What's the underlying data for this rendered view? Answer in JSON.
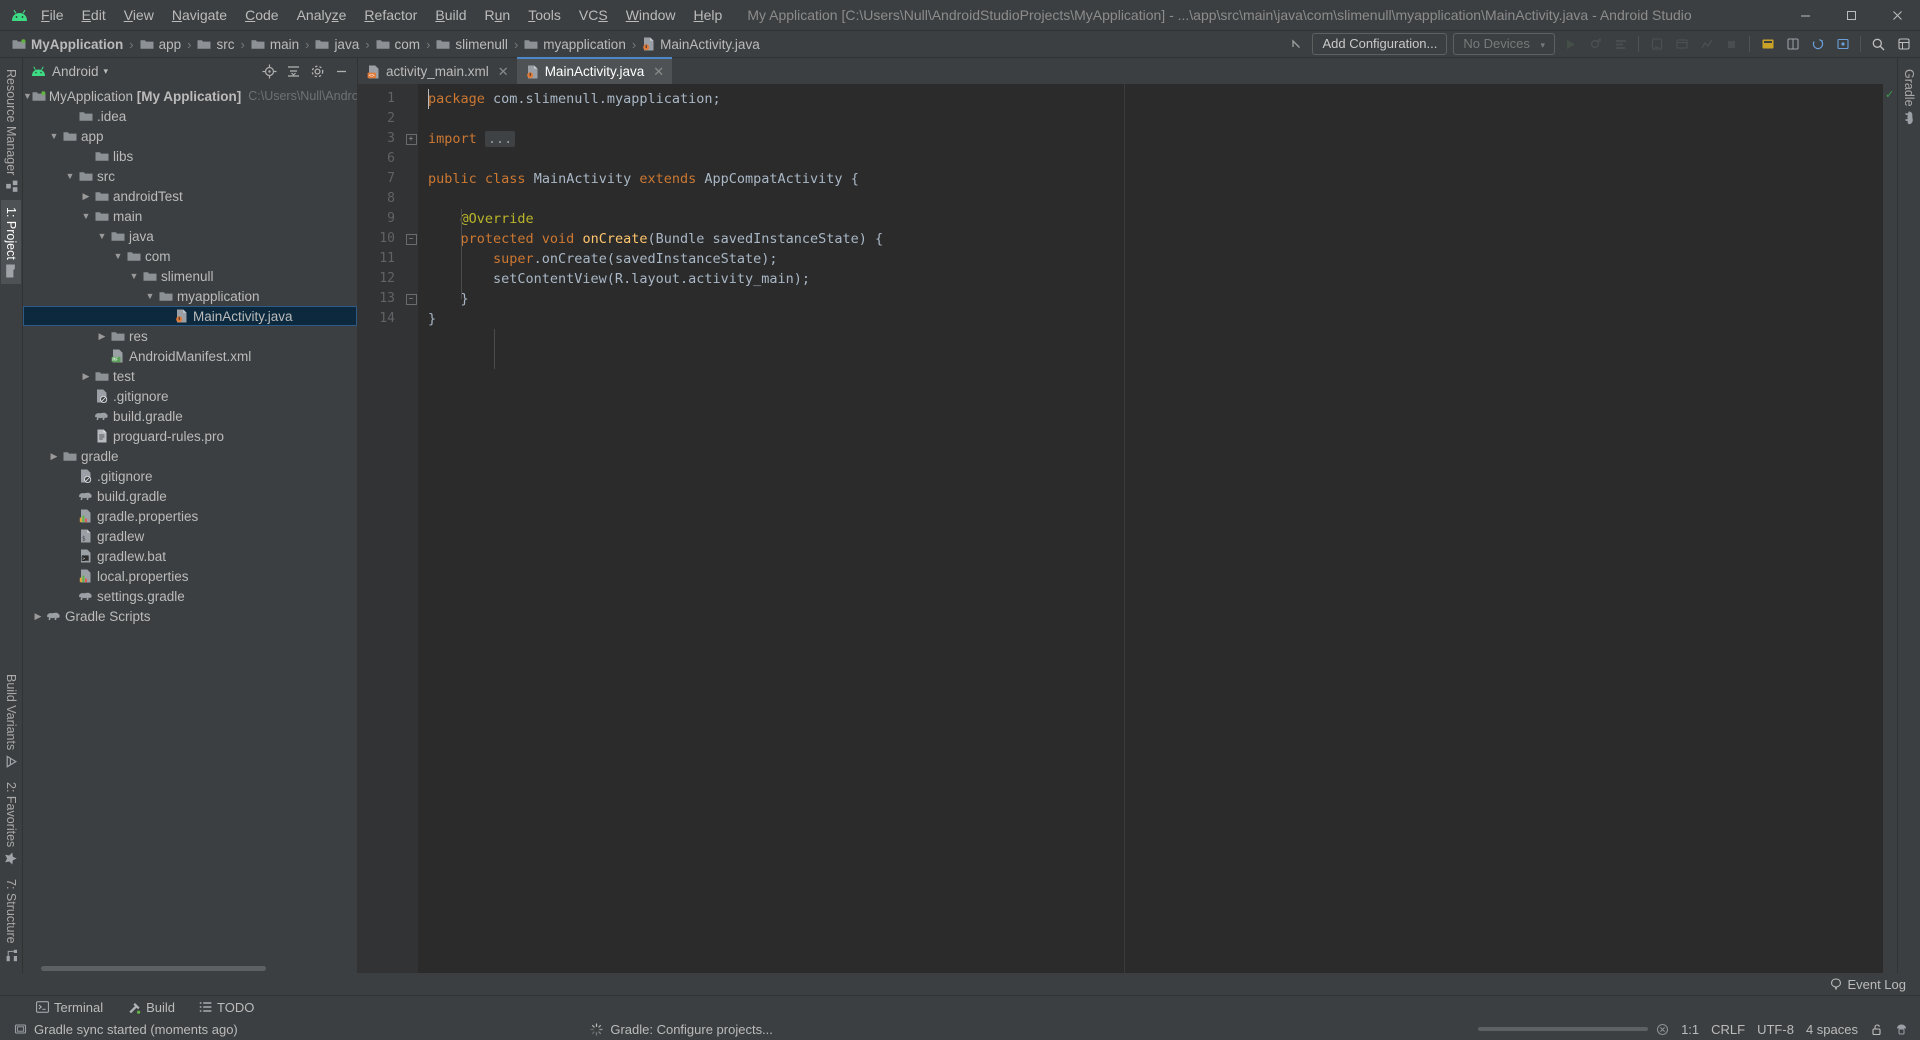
{
  "window": {
    "title": "My Application [C:\\Users\\Null\\AndroidStudioProjects\\MyApplication] - ...\\app\\src\\main\\java\\com\\slimenull\\myapplication\\MainActivity.java - Android Studio",
    "minimize_label": "─",
    "maximize_label": "❐",
    "close_label": "✕",
    "logo_icon": "android-logo-icon"
  },
  "menubar": {
    "items": [
      {
        "label": "File",
        "mnemonic": "F"
      },
      {
        "label": "Edit",
        "mnemonic": "E"
      },
      {
        "label": "View",
        "mnemonic": "V"
      },
      {
        "label": "Navigate",
        "mnemonic": "N"
      },
      {
        "label": "Code",
        "mnemonic": "C"
      },
      {
        "label": "Analyze",
        "mnemonic": "z"
      },
      {
        "label": "Refactor",
        "mnemonic": "R"
      },
      {
        "label": "Build",
        "mnemonic": "B"
      },
      {
        "label": "Run",
        "mnemonic": "u"
      },
      {
        "label": "Tools",
        "mnemonic": "T"
      },
      {
        "label": "VCS",
        "mnemonic": "S"
      },
      {
        "label": "Window",
        "mnemonic": "W"
      },
      {
        "label": "Help",
        "mnemonic": "H"
      }
    ]
  },
  "breadcrumb": {
    "items": [
      {
        "label": "MyApplication",
        "icon": "module-icon",
        "bold": true
      },
      {
        "label": "app",
        "icon": "folder-icon",
        "bold": false
      },
      {
        "label": "src",
        "icon": "folder-icon",
        "bold": false
      },
      {
        "label": "main",
        "icon": "folder-icon",
        "bold": false
      },
      {
        "label": "java",
        "icon": "folder-icon",
        "bold": false
      },
      {
        "label": "com",
        "icon": "folder-icon",
        "bold": false
      },
      {
        "label": "slimenull",
        "icon": "folder-icon",
        "bold": false
      },
      {
        "label": "myapplication",
        "icon": "folder-icon",
        "bold": false
      },
      {
        "label": "MainActivity.java",
        "icon": "java-class-icon",
        "bold": false
      }
    ],
    "separator": "›"
  },
  "toolbar": {
    "back_icon": "navigate-back-icon",
    "add_configuration_label": "Add Configuration...",
    "device_label": "No Devices",
    "device_caret": "▾",
    "icons": [
      {
        "name": "run-icon"
      },
      {
        "name": "debug-icon"
      },
      {
        "name": "run-with-coverage-icon"
      },
      {
        "name": "avd-manager-icon"
      },
      {
        "name": "sdk-manager-icon"
      },
      {
        "name": "profiler-icon"
      },
      {
        "name": "stop-icon"
      },
      {
        "name": "layout-inspector-icon"
      },
      {
        "name": "project-structure-icon"
      },
      {
        "name": "gradle-sync-icon"
      },
      {
        "name": "device-file-explorer-icon"
      },
      {
        "name": "search-icon"
      },
      {
        "name": "settings-icon"
      }
    ]
  },
  "left_strip": {
    "top": [
      {
        "label": "Resource Manager",
        "icon": "resource-manager-icon",
        "active": false
      },
      {
        "label": "1: Project",
        "icon": "project-folder-icon",
        "active": true
      }
    ],
    "bottom": [
      {
        "label": "Build Variants",
        "icon": "build-variants-icon",
        "active": false
      },
      {
        "label": "2: Favorites",
        "icon": "favorites-star-icon",
        "active": false
      },
      {
        "label": "7: Structure",
        "icon": "structure-icon",
        "active": false
      }
    ]
  },
  "right_strip": {
    "top": [
      {
        "label": "Gradle",
        "icon": "gradle-elephant-icon",
        "active": false
      }
    ],
    "bottom": []
  },
  "project_panel": {
    "view_selector": "Android",
    "view_caret": "▾",
    "android_icon": "android-head-icon",
    "locate_icon": "locate-target-icon",
    "collapse_icon": "collapse-all-icon",
    "settings_icon": "gear-icon",
    "hide_icon": "hide-panel-icon",
    "tree": [
      {
        "label": "MyApplication",
        "suffix": "[My Application]",
        "path": "C:\\Users\\Null\\Android",
        "depth": 0,
        "arrow": "down",
        "icon": "module-icon"
      },
      {
        "label": ".idea",
        "depth": 2,
        "arrow": "none",
        "icon": "folder-icon"
      },
      {
        "label": "app",
        "depth": 1,
        "arrow": "down",
        "icon": "folder-icon"
      },
      {
        "label": "libs",
        "depth": 3,
        "arrow": "none",
        "icon": "folder-icon"
      },
      {
        "label": "src",
        "depth": 2,
        "arrow": "down",
        "icon": "folder-icon"
      },
      {
        "label": "androidTest",
        "depth": 3,
        "arrow": "right",
        "icon": "folder-icon"
      },
      {
        "label": "main",
        "depth": 3,
        "arrow": "down",
        "icon": "folder-icon"
      },
      {
        "label": "java",
        "depth": 4,
        "arrow": "down",
        "icon": "folder-icon"
      },
      {
        "label": "com",
        "depth": 5,
        "arrow": "down",
        "icon": "folder-icon"
      },
      {
        "label": "slimenull",
        "depth": 6,
        "arrow": "down",
        "icon": "folder-icon"
      },
      {
        "label": "myapplication",
        "depth": 7,
        "arrow": "down",
        "icon": "folder-icon"
      },
      {
        "label": "MainActivity.java",
        "depth": 8,
        "arrow": "none",
        "icon": "java-class-icon",
        "selected": true
      },
      {
        "label": "res",
        "depth": 4,
        "arrow": "right",
        "icon": "folder-icon"
      },
      {
        "label": "AndroidManifest.xml",
        "depth": 4,
        "arrow": "none",
        "icon": "manifest-icon"
      },
      {
        "label": "test",
        "depth": 3,
        "arrow": "right",
        "icon": "folder-icon"
      },
      {
        "label": ".gitignore",
        "depth": 3,
        "arrow": "none",
        "icon": "gitignore-icon"
      },
      {
        "label": "build.gradle",
        "depth": 3,
        "arrow": "none",
        "icon": "gradle-file-icon"
      },
      {
        "label": "proguard-rules.pro",
        "depth": 3,
        "arrow": "none",
        "icon": "text-file-icon"
      },
      {
        "label": "gradle",
        "depth": 1,
        "arrow": "right",
        "icon": "folder-icon"
      },
      {
        "label": ".gitignore",
        "depth": 2,
        "arrow": "none",
        "icon": "gitignore-icon"
      },
      {
        "label": "build.gradle",
        "depth": 2,
        "arrow": "none",
        "icon": "gradle-file-icon"
      },
      {
        "label": "gradle.properties",
        "depth": 2,
        "arrow": "none",
        "icon": "properties-icon"
      },
      {
        "label": "gradlew",
        "depth": 2,
        "arrow": "none",
        "icon": "script-icon"
      },
      {
        "label": "gradlew.bat",
        "depth": 2,
        "arrow": "none",
        "icon": "bat-icon"
      },
      {
        "label": "local.properties",
        "depth": 2,
        "arrow": "none",
        "icon": "properties-icon"
      },
      {
        "label": "settings.gradle",
        "depth": 2,
        "arrow": "none",
        "icon": "gradle-file-icon"
      },
      {
        "label": "Gradle Scripts",
        "depth": 0,
        "arrow": "right",
        "icon": "gradle-elephant-icon"
      }
    ]
  },
  "editor": {
    "tabs": [
      {
        "label": "activity_main.xml",
        "icon": "xml-layout-icon",
        "active": false,
        "close": "✕"
      },
      {
        "label": "MainActivity.java",
        "icon": "java-class-icon",
        "active": true,
        "close": "✕"
      }
    ],
    "line_numbers": [
      "1",
      "2",
      "3",
      "6",
      "7",
      "8",
      "9",
      "10",
      "11",
      "12",
      "13",
      "14"
    ],
    "lines": [
      {
        "num": "1",
        "tokens": [
          {
            "t": "package ",
            "c": "kw"
          },
          {
            "t": "com.slimenull.myapplication;",
            "c": ""
          }
        ]
      },
      {
        "num": "2",
        "tokens": []
      },
      {
        "num": "3",
        "tokens": [
          {
            "t": "import ",
            "c": "kw"
          },
          {
            "t": "...",
            "c": "fold"
          }
        ],
        "fold": "minus"
      },
      {
        "num": "6",
        "tokens": []
      },
      {
        "num": "7",
        "tokens": [
          {
            "t": "public ",
            "c": "kw"
          },
          {
            "t": "class ",
            "c": "kw"
          },
          {
            "t": "MainActivity ",
            "c": ""
          },
          {
            "t": "extends ",
            "c": "kw"
          },
          {
            "t": "AppCompatActivity {",
            "c": ""
          }
        ]
      },
      {
        "num": "8",
        "tokens": []
      },
      {
        "num": "9",
        "tokens": [
          {
            "t": "    @Override",
            "c": "an"
          }
        ]
      },
      {
        "num": "10",
        "tokens": [
          {
            "t": "    ",
            "c": ""
          },
          {
            "t": "protected ",
            "c": "kw"
          },
          {
            "t": "void ",
            "c": "kw"
          },
          {
            "t": "onCreate",
            "c": "fn"
          },
          {
            "t": "(Bundle savedInstanceState) {",
            "c": ""
          }
        ],
        "fold": "minus"
      },
      {
        "num": "11",
        "tokens": [
          {
            "t": "        ",
            "c": ""
          },
          {
            "t": "super",
            "c": "kw"
          },
          {
            "t": ".onCreate(savedInstanceState);",
            "c": ""
          }
        ]
      },
      {
        "num": "12",
        "tokens": [
          {
            "t": "        setContentView(R.layout.activity_main);",
            "c": ""
          }
        ]
      },
      {
        "num": "13",
        "tokens": [
          {
            "t": "    }",
            "c": ""
          }
        ],
        "fold": "minus"
      },
      {
        "num": "14",
        "tokens": [
          {
            "t": "}",
            "c": ""
          }
        ]
      }
    ],
    "analysis_status": "✓"
  },
  "bottom_tabs": [
    {
      "label": "Terminal",
      "icon": "terminal-icon"
    },
    {
      "label": "Build",
      "icon": "build-hammer-icon"
    },
    {
      "label": "TODO",
      "icon": "todo-list-icon"
    }
  ],
  "event_log": {
    "label": "Event Log",
    "icon": "event-log-icon"
  },
  "statusbar": {
    "message": "Gradle sync started (moments ago)",
    "message_icon": "status-balloon-icon",
    "progress_label": "Gradle: Configure projects...",
    "progress_icon": "spinner-icon",
    "stop_icon": "stop-progress-icon",
    "caret_position": "1:1",
    "line_separator": "CRLF",
    "encoding": "UTF-8",
    "indent": "4 spaces",
    "lock_icon": "unlocked-icon",
    "inspection_icon": "inspection-hector-icon"
  },
  "colors": {
    "accent_blue": "#4a88c7",
    "selection_blue": "#0d293e",
    "android_green": "#3ddc84",
    "keyword_orange": "#cc7832",
    "method_yellow": "#ffc66d",
    "annotation_olive": "#bbb529",
    "bg_panel": "#3c3f41",
    "bg_editor": "#2b2b2b"
  }
}
